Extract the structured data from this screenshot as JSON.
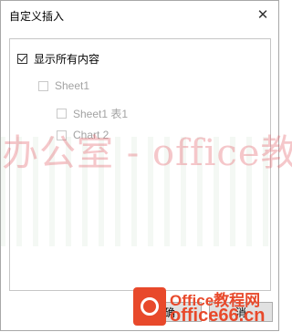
{
  "dialog": {
    "title": "自定义插入",
    "close_glyph": "✕"
  },
  "tree": {
    "root": {
      "label": "显示所有内容",
      "checked": true,
      "enabled": true
    },
    "items": [
      {
        "label": "Sheet1",
        "checked": false,
        "enabled": false
      },
      {
        "label": "Sheet1 表1",
        "checked": false,
        "enabled": false
      },
      {
        "label": "Chart 2",
        "checked": false,
        "enabled": false
      }
    ]
  },
  "footer": {
    "left_button_label": "确",
    "right_button_label": "消"
  },
  "watermark": {
    "text": "办公室 - office教程网",
    "logo_line1": "Office教程网",
    "logo_line2": "office66.cn",
    "color": "#e8492b"
  }
}
